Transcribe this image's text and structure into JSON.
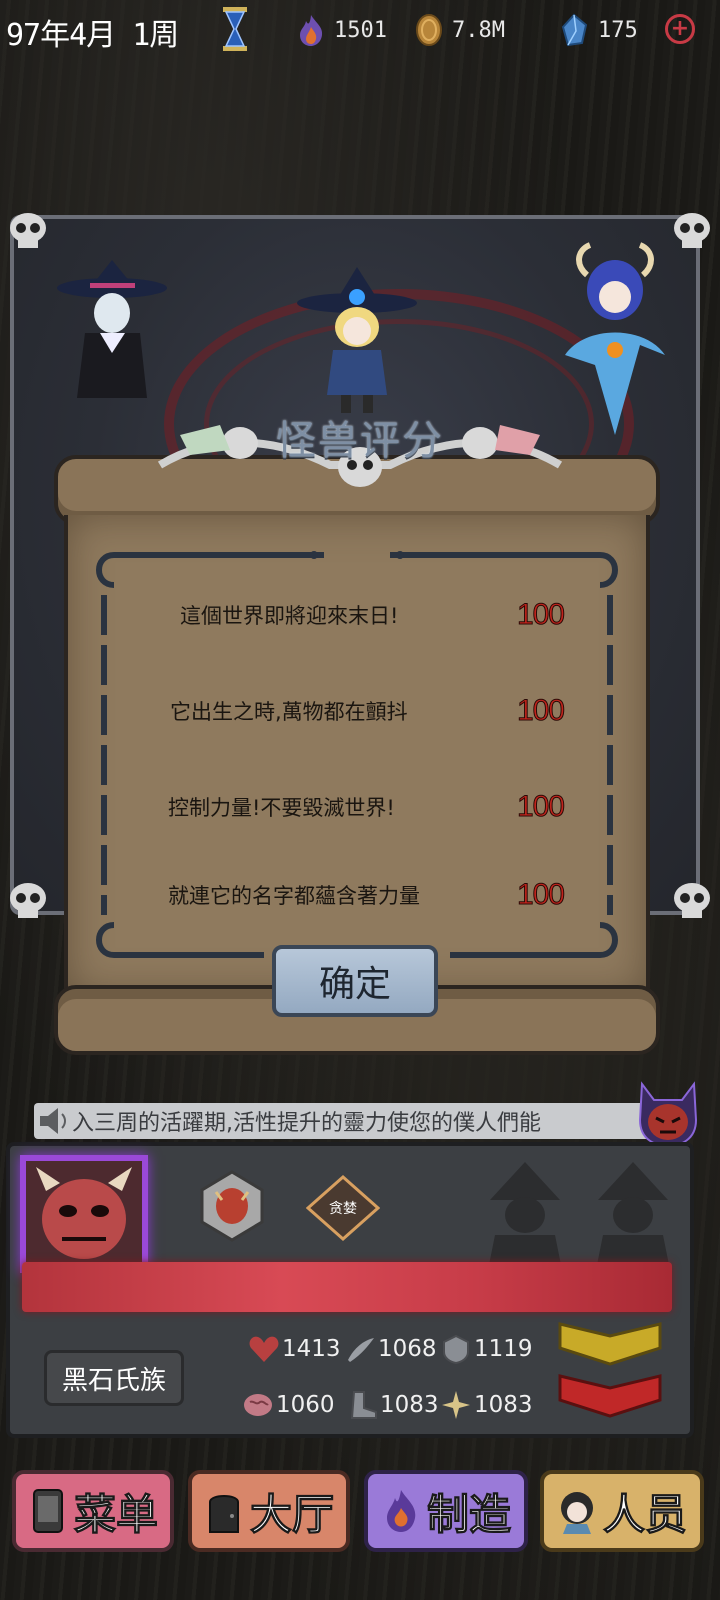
{
  "topbar": {
    "date": "97年4月 1周",
    "resources": [
      {
        "icon": "soul-flame-icon",
        "value": "1501"
      },
      {
        "icon": "gold-coin-icon",
        "value": "7.8M"
      },
      {
        "icon": "blue-crystal-icon",
        "value": "175"
      }
    ],
    "plus": "+"
  },
  "dialog": {
    "title": "怪兽评分",
    "rows": [
      {
        "text": "這個世界即將迎來末日!",
        "score": "100"
      },
      {
        "text": "它出生之時,萬物都在顫抖",
        "score": "100"
      },
      {
        "text": "控制力量!不要毀滅世界!",
        "score": "100"
      },
      {
        "text": "就連它的名字都蘊含著力量",
        "score": "100"
      }
    ],
    "confirm": "确定"
  },
  "ticker": {
    "message": "入三周的活躍期,活性提升的靈力使您的僕人們能"
  },
  "character": {
    "trait": "贪婪",
    "clan": "黑石氏族",
    "stats": {
      "health": "1413",
      "attack": "1068",
      "defense": "1119",
      "intellect": "1060",
      "speed": "1083",
      "magic": "1083"
    }
  },
  "nav": {
    "menu": "菜单",
    "hall": "大厅",
    "craft": "制造",
    "staff": "人员"
  },
  "colors": {
    "score_red": "#c0241c",
    "portrait_glow": "#9a49d8",
    "title_blue": "#7e8fa4"
  }
}
